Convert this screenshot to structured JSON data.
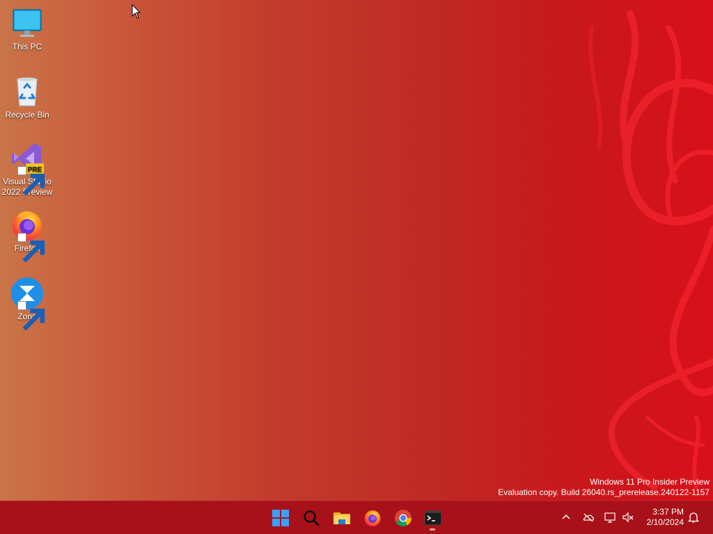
{
  "desktop": {
    "icons": [
      {
        "label": "This PC",
        "icon": "monitor-icon"
      },
      {
        "label": "Recycle Bin",
        "icon": "recycle-bin-icon"
      },
      {
        "label": "Visual Studio 2022 Preview",
        "icon": "visual-studio-icon",
        "badge": "PRE"
      },
      {
        "label": "Firefox",
        "icon": "firefox-icon"
      },
      {
        "label": "Zona",
        "icon": "zona-icon"
      }
    ],
    "watermark": {
      "line1": "Windows 11 Pro Insider Preview",
      "line2": "Evaluation copy. Build 26040.rs_prerelease.240122-1157"
    }
  },
  "taskbar": {
    "apps": [
      {
        "name": "Start",
        "icon": "windows-logo-icon"
      },
      {
        "name": "Search",
        "icon": "search-icon"
      },
      {
        "name": "File Explorer",
        "icon": "folder-icon"
      },
      {
        "name": "Firefox",
        "icon": "firefox-icon"
      },
      {
        "name": "Google Chrome",
        "icon": "chrome-icon"
      },
      {
        "name": "Terminal",
        "icon": "terminal-icon",
        "running": true
      }
    ],
    "tray": {
      "icons": [
        "chevron-up-icon",
        "onedrive-icon",
        "network-icon",
        "volume-muted-icon",
        "notification-bell-icon"
      ],
      "time": "3:37 PM",
      "date": "2/10/2024"
    },
    "colors": {
      "taskbar_bg": "#a81119",
      "accent_blue": "#0a84ff"
    }
  }
}
